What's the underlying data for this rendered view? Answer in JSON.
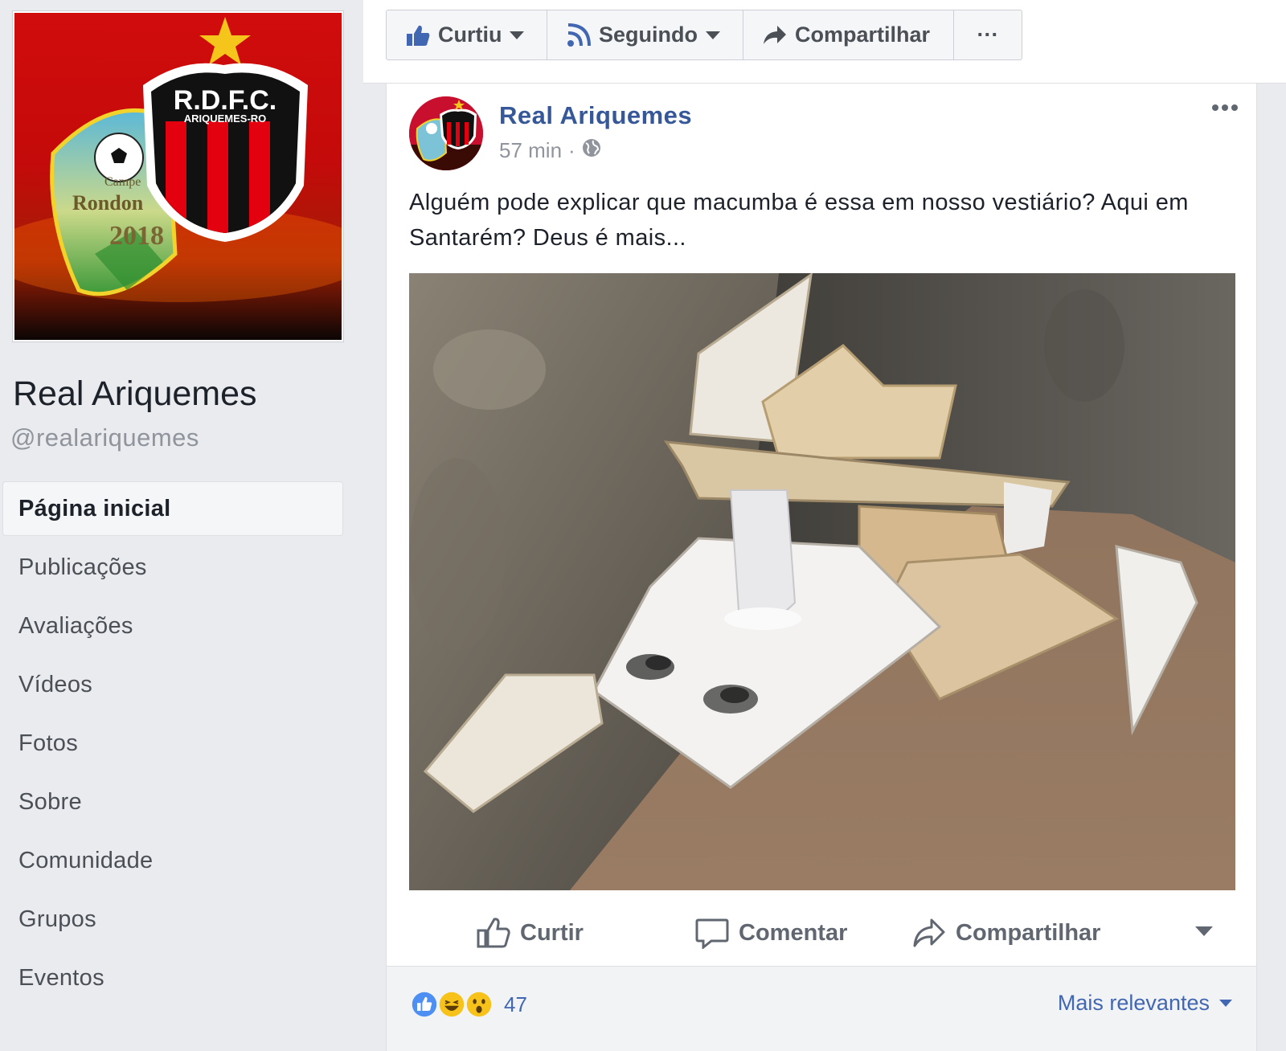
{
  "page": {
    "name": "Real Ariquemes",
    "handle": "@realariquemes",
    "logo_text": "R.D.F.C.",
    "logo_subtext": "ARIQUEMES-RO",
    "badge_text_1": "Campe",
    "badge_text_2": "Rondon",
    "badge_year": "2018"
  },
  "nav": {
    "items": [
      {
        "label": "Página inicial",
        "active": true
      },
      {
        "label": "Publicações"
      },
      {
        "label": "Avaliações"
      },
      {
        "label": "Vídeos"
      },
      {
        "label": "Fotos"
      },
      {
        "label": "Sobre"
      },
      {
        "label": "Comunidade"
      },
      {
        "label": "Grupos"
      },
      {
        "label": "Eventos"
      }
    ]
  },
  "top_actions": {
    "liked_label": "Curtiu",
    "following_label": "Seguindo",
    "share_label": "Compartilhar",
    "more_label": "···"
  },
  "post": {
    "author": "Real Ariquemes",
    "time": "57 min",
    "separator": "·",
    "privacy_icon": "globe-icon",
    "text": "Alguém pode explicar que macumba é essa em nosso vestiário? Aqui em Santarém? Deus é mais...",
    "options_icon": "ellipsis-icon",
    "actions": {
      "like": "Curtir",
      "comment": "Comentar",
      "share": "Compartilhar"
    },
    "reactions": {
      "count": "47",
      "types": [
        "like",
        "haha",
        "wow"
      ]
    },
    "sort_label": "Mais relevantes"
  },
  "colors": {
    "fb_blue": "#4267b2",
    "link_blue": "#365899",
    "background": "#e9ebee",
    "club_red": "#e3000f",
    "club_black": "#111111"
  }
}
